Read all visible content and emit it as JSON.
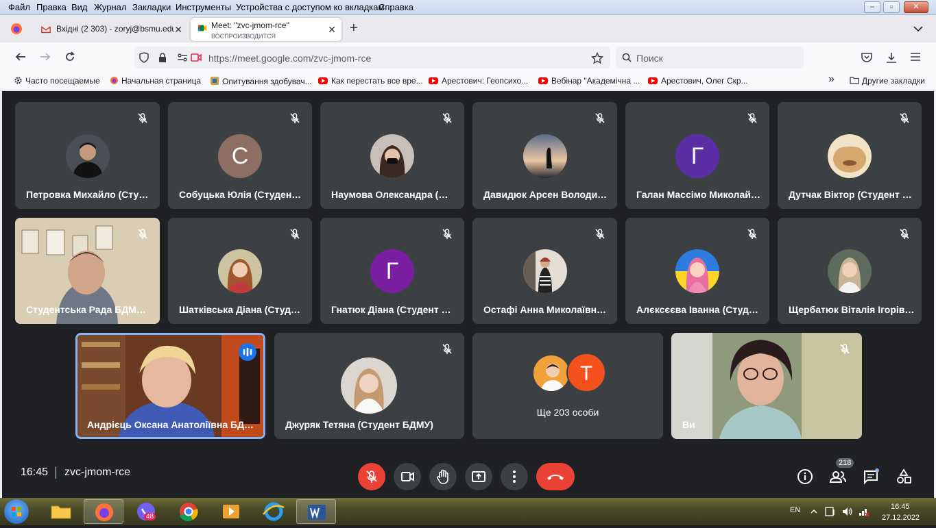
{
  "menubar": {
    "items": [
      "Файл",
      "Правка",
      "Вид",
      "Журнал",
      "Закладки",
      "Инструменты",
      "Устройства с доступом ко вкладкам",
      "Справка"
    ],
    "controls": [
      "–",
      "▫",
      "✕"
    ]
  },
  "tabs": [
    {
      "title": "Вхідні (2 303) - zoryj@bsmu.edu",
      "close": "✕"
    },
    {
      "title": "Meet: \"zvc-jmom-rce\"",
      "subtitle": "ВОСПРОИЗВОДИТСЯ",
      "close": "✕"
    }
  ],
  "newtab": "+",
  "navbar": {
    "url_host": "https://meet.google.com",
    "url_path": "/zvc-jmom-rce",
    "search_placeholder": "Поиск"
  },
  "bookmarks": {
    "items": [
      "Часто посещаемые",
      "Начальная страница",
      "Опитування здобувач...",
      "Как перестать все вре...",
      "Арестович: Геопсихо...",
      "Вебінар \"Академічна ...",
      "Арестович, Олег Скр..."
    ],
    "more": "»",
    "other": "Другие закладки"
  },
  "participants_row1": [
    {
      "name": "Петровка Михайло (Сту…",
      "avatar_type": "photo",
      "avatar_color": "#2b3036"
    },
    {
      "name": "Собуцька Юлія (Студен…",
      "avatar_type": "letter",
      "letter": "С",
      "avatar_color": "#8d6e63"
    },
    {
      "name": "Наумова Олександра (…",
      "avatar_type": "photo",
      "avatar_color": "#6b5a54"
    },
    {
      "name": "Давидюк Арсен Володи…",
      "avatar_type": "photo",
      "avatar_color": "#8a9bb3"
    },
    {
      "name": "Галан Массімо Миколай…",
      "avatar_type": "letter",
      "letter": "Г",
      "avatar_color": "#5b2ea6"
    },
    {
      "name": "Дутчак Віктор (Студент …",
      "avatar_type": "photo",
      "avatar_color": "#d7a86e"
    }
  ],
  "participants_row2": [
    {
      "name": "Студентська Рада БДМ…",
      "avatar_type": "video",
      "avatar_color": "#c9bfa6"
    },
    {
      "name": "Шатківська Діана (Студ…",
      "avatar_type": "photo",
      "avatar_color": "#a35d4a"
    },
    {
      "name": "Гнатюк Діана (Студент …",
      "avatar_type": "letter",
      "letter": "Г",
      "avatar_color": "#7b1fa2"
    },
    {
      "name": "Остафі Анна Миколаївн…",
      "avatar_type": "photo",
      "avatar_color": "#8e8f8f"
    },
    {
      "name": "Алєксєєва Іванна (Студ…",
      "avatar_type": "photo",
      "avatar_color": "#e88aa8"
    },
    {
      "name": "Щербатюк Віталія Ігорів…",
      "avatar_type": "photo",
      "avatar_color": "#5f6b5c"
    }
  ],
  "participants_row3": [
    {
      "name": "Андрієць Оксана Анатоліївна БД…",
      "avatar_type": "video"
    },
    {
      "name": "Джуряк Тетяна (Студент БДМУ)",
      "avatar_type": "photo",
      "avatar_color": "#c5b7a8"
    },
    {
      "more_label": "Ще 203 особи",
      "letter": "Т",
      "avatar_color": "#f4511e"
    },
    {
      "name": "Ви",
      "avatar_type": "video"
    }
  ],
  "bottombar": {
    "time": "16:45",
    "separator": "|",
    "meeting_code": "zvc-jmom-rce",
    "people_count": "218"
  },
  "taskbar": {
    "viber_badge": "48",
    "lang": "EN",
    "time": "16:45",
    "date": "27.12.2022"
  }
}
